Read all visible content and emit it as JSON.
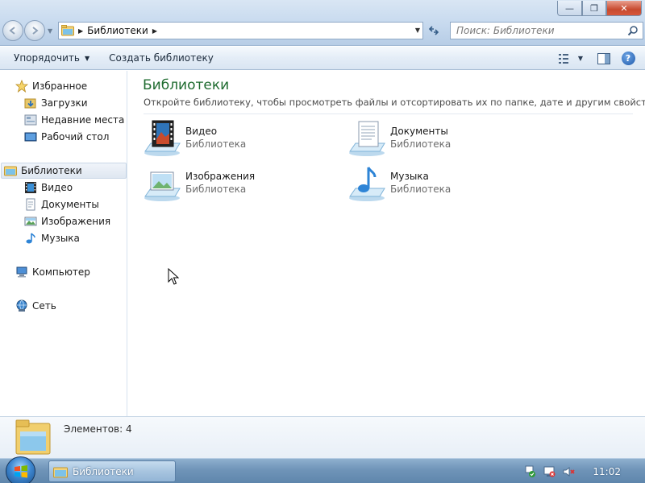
{
  "window": {
    "caption_buttons": {
      "minimize": "—",
      "maximize": "❐",
      "close": "✕"
    }
  },
  "navigation": {
    "back_icon": "back-arrow-icon",
    "forward_icon": "forward-arrow-icon"
  },
  "address": {
    "breadcrumb": "Библиотеки",
    "refresh_icon": "refresh-icon"
  },
  "search": {
    "placeholder": "Поиск: Библиотеки"
  },
  "toolbar": {
    "organize_label": "Упорядочить",
    "create_library_label": "Создать библиотеку",
    "help_label": "?"
  },
  "navpane": {
    "favorites": {
      "label": "Избранное",
      "items": [
        {
          "label": "Загрузки",
          "icon": "downloads-folder-icon"
        },
        {
          "label": "Недавние места",
          "icon": "recent-places-icon"
        },
        {
          "label": "Рабочий стол",
          "icon": "desktop-icon"
        }
      ]
    },
    "libraries": {
      "label": "Библиотеки",
      "items": [
        {
          "label": "Видео",
          "icon": "video-icon"
        },
        {
          "label": "Документы",
          "icon": "documents-icon"
        },
        {
          "label": "Изображения",
          "icon": "pictures-icon"
        },
        {
          "label": "Музыка",
          "icon": "music-icon"
        }
      ]
    },
    "computer": {
      "label": "Компьютер"
    },
    "network": {
      "label": "Сеть"
    }
  },
  "content": {
    "title": "Библиотеки",
    "description": "Откройте библиотеку, чтобы просмотреть файлы и отсортировать их по папке, дате и другим свойствам.",
    "libraries": [
      {
        "name": "Видео",
        "type": "Библиотека",
        "icon": "video-library-icon"
      },
      {
        "name": "Документы",
        "type": "Библиотека",
        "icon": "documents-library-icon"
      },
      {
        "name": "Изображения",
        "type": "Библиотека",
        "icon": "pictures-library-icon"
      },
      {
        "name": "Музыка",
        "type": "Библиотека",
        "icon": "music-library-icon"
      }
    ]
  },
  "details": {
    "items_count": "Элементов: 4"
  },
  "taskbar": {
    "start_icon": "windows-start-orb",
    "task_label": "Библиотеки",
    "clock": "11:02"
  },
  "colors": {
    "title_green": "#1e6b2f",
    "chrome_blue": "#c6d9ee",
    "taskbar_blue": "#6f94b8"
  }
}
